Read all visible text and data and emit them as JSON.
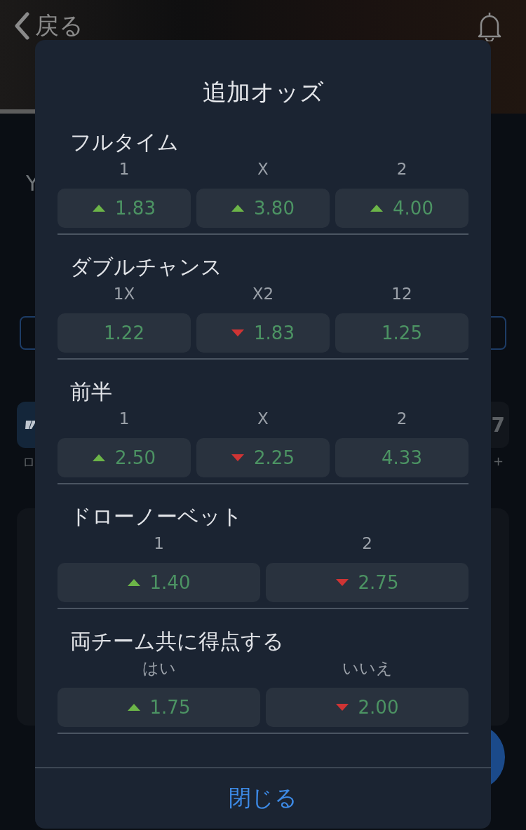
{
  "header": {
    "back_label": "戻る"
  },
  "background": {
    "team_initials": [
      "Y"
    ],
    "card_left_caption": "ロ",
    "card_right_value": "7",
    "card_right_caption": "+"
  },
  "modal": {
    "title": "追加オッズ",
    "markets": [
      {
        "title": "フルタイム",
        "options": [
          {
            "label": "1",
            "odds": "1.83",
            "rising": true,
            "falling": false
          },
          {
            "label": "X",
            "odds": "3.80",
            "rising": true,
            "falling": false
          },
          {
            "label": "2",
            "odds": "4.00",
            "rising": true,
            "falling": false
          }
        ]
      },
      {
        "title": "ダブルチャンス",
        "options": [
          {
            "label": "1X",
            "odds": "1.22",
            "rising": false,
            "falling": false
          },
          {
            "label": "X2",
            "odds": "1.83",
            "rising": false,
            "falling": true
          },
          {
            "label": "12",
            "odds": "1.25",
            "rising": false,
            "falling": false
          }
        ]
      },
      {
        "title": "前半",
        "options": [
          {
            "label": "1",
            "odds": "2.50",
            "rising": true,
            "falling": false
          },
          {
            "label": "X",
            "odds": "2.25",
            "rising": false,
            "falling": true
          },
          {
            "label": "2",
            "odds": "4.33",
            "rising": false,
            "falling": false
          }
        ]
      },
      {
        "title": "ドローノーベット",
        "options": [
          {
            "label": "1",
            "odds": "1.40",
            "rising": true,
            "falling": false
          },
          {
            "label": "2",
            "odds": "2.75",
            "rising": false,
            "falling": true
          }
        ]
      },
      {
        "title": "両チーム共に得点する",
        "options": [
          {
            "label": "はい",
            "odds": "1.75",
            "rising": true,
            "falling": false
          },
          {
            "label": "いいえ",
            "odds": "2.00",
            "rising": false,
            "falling": true
          }
        ]
      }
    ],
    "close_label": "閉じる"
  }
}
